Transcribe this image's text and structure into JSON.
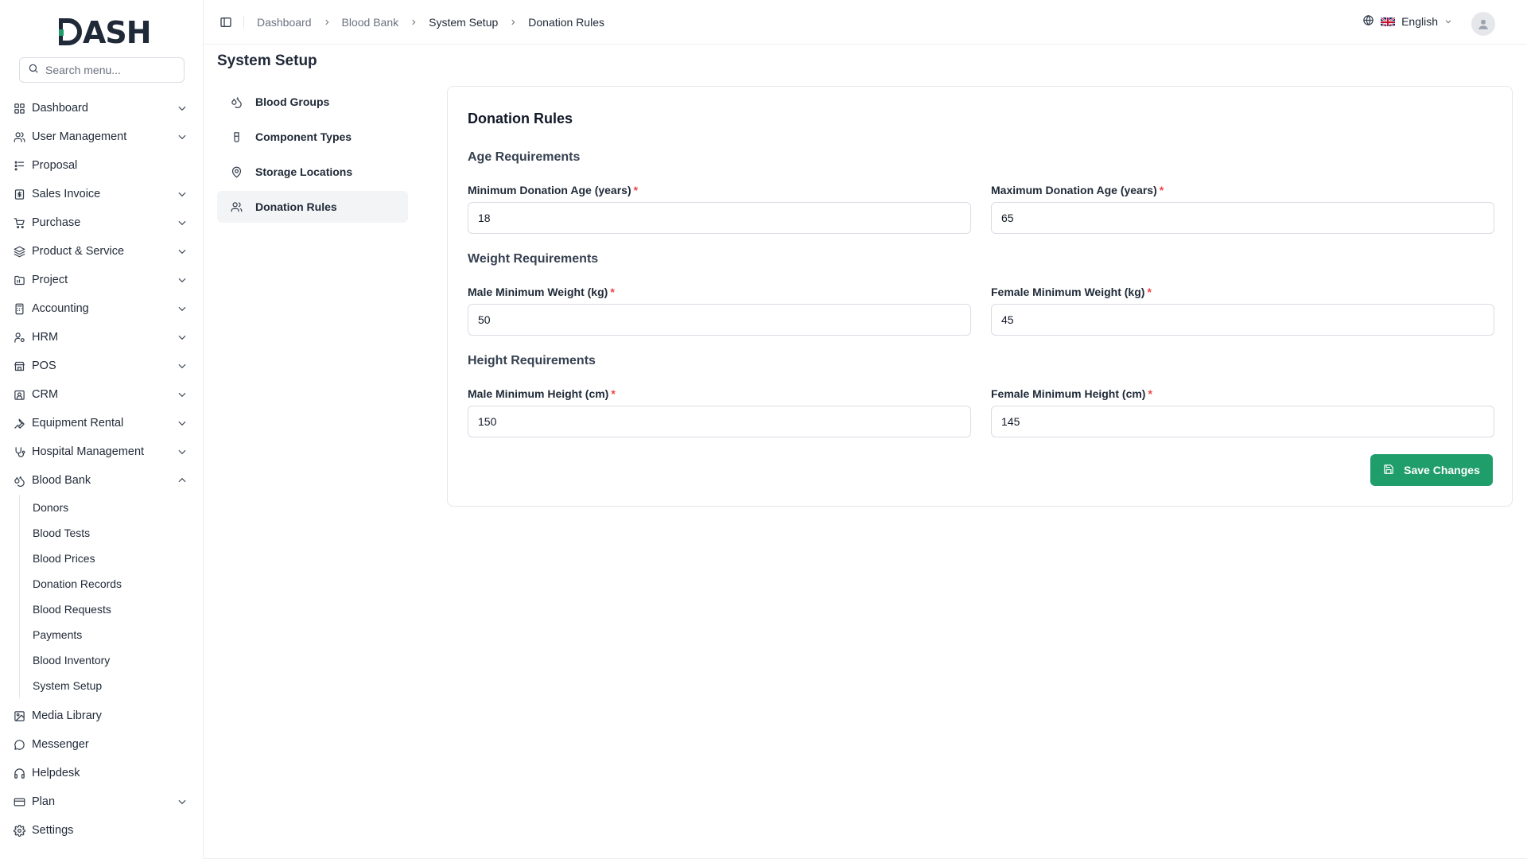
{
  "brand": {
    "logo_text": "DASH"
  },
  "search": {
    "placeholder": "Search menu..."
  },
  "sidebar": {
    "items": [
      {
        "label": "Dashboard",
        "icon": "grid-icon",
        "chevron": "down"
      },
      {
        "label": "User Management",
        "icon": "users-icon",
        "chevron": "down"
      },
      {
        "label": "Proposal",
        "icon": "proposal-icon",
        "chevron": ""
      },
      {
        "label": "Sales Invoice",
        "icon": "invoice-icon",
        "chevron": "down"
      },
      {
        "label": "Purchase",
        "icon": "cart-icon",
        "chevron": "down"
      },
      {
        "label": "Product & Service",
        "icon": "layers-icon",
        "chevron": "down"
      },
      {
        "label": "Project",
        "icon": "folder-icon",
        "chevron": "down"
      },
      {
        "label": "Accounting",
        "icon": "calculator-icon",
        "chevron": "down"
      },
      {
        "label": "HRM",
        "icon": "hrm-icon",
        "chevron": "down"
      },
      {
        "label": "POS",
        "icon": "store-icon",
        "chevron": "down"
      },
      {
        "label": "CRM",
        "icon": "crm-icon",
        "chevron": "down"
      },
      {
        "label": "Equipment Rental",
        "icon": "wrench-icon",
        "chevron": "down"
      },
      {
        "label": "Hospital Management",
        "icon": "stethoscope-icon",
        "chevron": "down"
      },
      {
        "label": "Blood Bank",
        "icon": "droplets-icon",
        "chevron": "up"
      }
    ],
    "blood_bank_sub": [
      "Donors",
      "Blood Tests",
      "Blood Prices",
      "Donation Records",
      "Blood Requests",
      "Payments",
      "Blood Inventory",
      "System Setup"
    ],
    "items_after": [
      {
        "label": "Media Library",
        "icon": "image-icon",
        "chevron": ""
      },
      {
        "label": "Messenger",
        "icon": "message-icon",
        "chevron": ""
      },
      {
        "label": "Helpdesk",
        "icon": "headphones-icon",
        "chevron": ""
      },
      {
        "label": "Plan",
        "icon": "card-icon",
        "chevron": "down"
      },
      {
        "label": "Settings",
        "icon": "gear-icon",
        "chevron": ""
      }
    ]
  },
  "header": {
    "breadcrumb": [
      "Dashboard",
      "Blood Bank",
      "System Setup",
      "Donation Rules"
    ],
    "language": "English"
  },
  "page": {
    "title": "System Setup",
    "setup_menu": [
      {
        "label": "Blood Groups",
        "icon": "droplets-icon"
      },
      {
        "label": "Component Types",
        "icon": "beaker-icon"
      },
      {
        "label": "Storage Locations",
        "icon": "map-pin-icon"
      },
      {
        "label": "Donation Rules",
        "icon": "users-icon"
      }
    ]
  },
  "form": {
    "title": "Donation Rules",
    "age_section": "Age Requirements",
    "min_age_label": "Minimum Donation Age (years)",
    "min_age_value": "18",
    "max_age_label": "Maximum Donation Age (years)",
    "max_age_value": "65",
    "weight_section": "Weight Requirements",
    "male_weight_label": "Male Minimum Weight (kg)",
    "male_weight_value": "50",
    "female_weight_label": "Female Minimum Weight (kg)",
    "female_weight_value": "45",
    "height_section": "Height Requirements",
    "male_height_label": "Male Minimum Height (cm)",
    "male_height_value": "150",
    "female_height_label": "Female Minimum Height (cm)",
    "female_height_value": "145",
    "required_mark": "*",
    "save_label": "Save Changes"
  },
  "colors": {
    "accent": "#1f9d6b",
    "required": "#ef4444"
  }
}
